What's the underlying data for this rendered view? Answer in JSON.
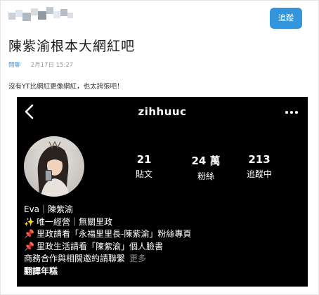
{
  "post": {
    "title": "陳紫渝根本大網紅吧",
    "board": "閒聊",
    "timestamp": "2月17日 15:27",
    "body": "沒有YT比網紅更像網紅，也太誇張吧！",
    "follow_label": "追蹤"
  },
  "ig_profile": {
    "username": "zihhuuc",
    "stats": [
      {
        "value": "21",
        "label": "貼文"
      },
      {
        "value": "24 萬",
        "label": "粉絲"
      },
      {
        "value": "213",
        "label": "追蹤中"
      }
    ],
    "bio": {
      "name_line": "Eva｜陳紫渝",
      "line1": "唯一經營｜無關里政",
      "line2": "里政請看「永福里里長-陳紫渝」粉絲專頁",
      "line3": "里政生活請看「陳紫渝」個人臉書",
      "line4": "商務合作與相關邀約請聯繫",
      "more": "更多",
      "translate": "翻譯年糕"
    },
    "emoji": {
      "sparkle": "✨",
      "pin": "📌"
    }
  },
  "colors": {
    "accent": "#3396dc",
    "board_link": "#3d93d6",
    "ig_background": "#000000"
  },
  "icons": [
    "back-chevron-icon",
    "more-dots-icon",
    "sparkles-icon",
    "pushpin-icon"
  ]
}
